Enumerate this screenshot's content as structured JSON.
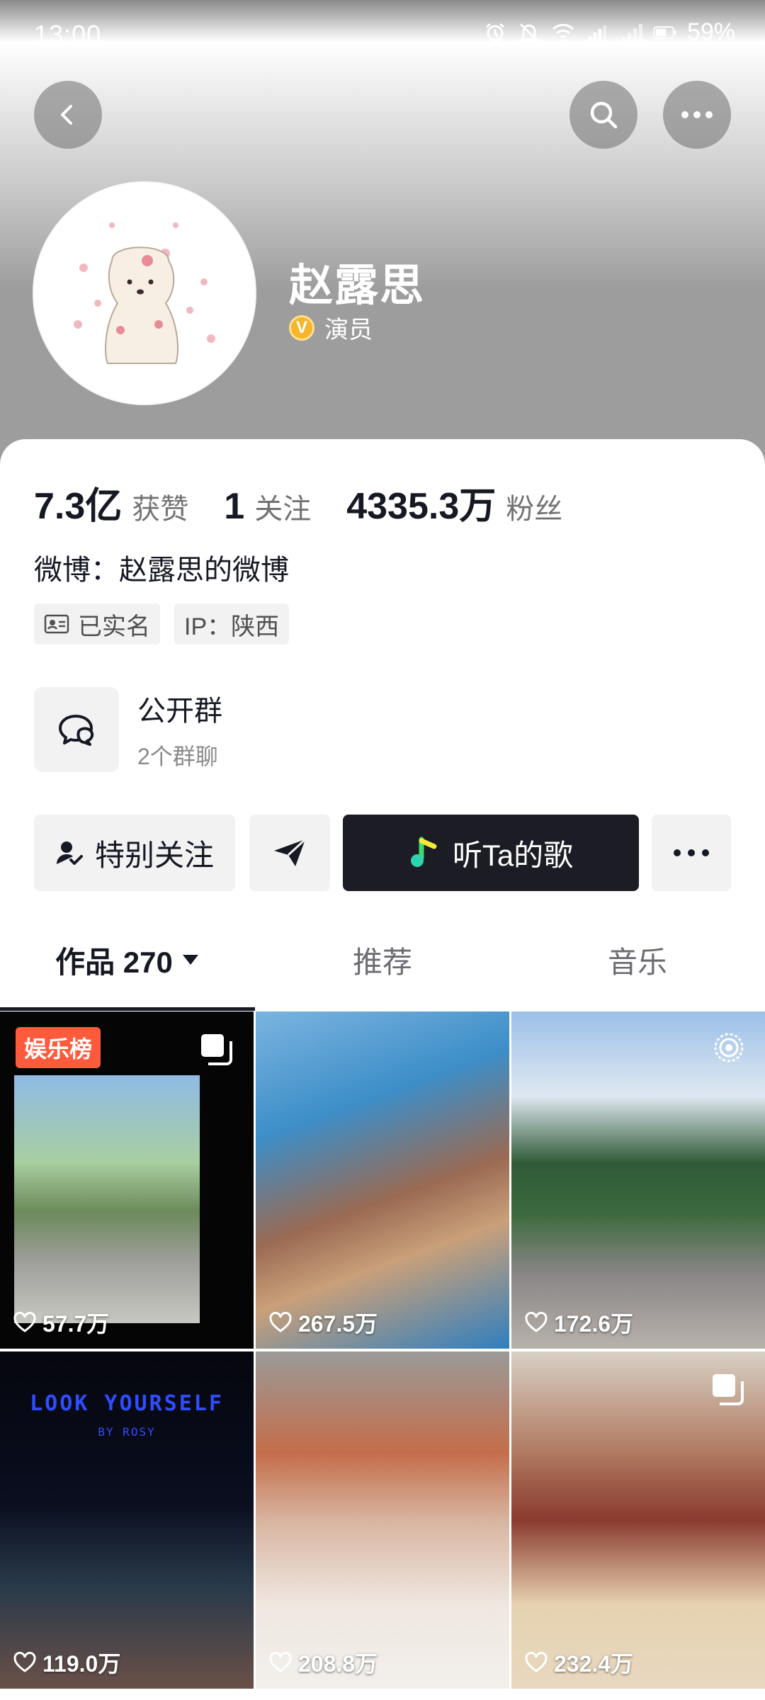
{
  "status_bar": {
    "time": "13:00",
    "battery": "59%"
  },
  "profile": {
    "name": "赵露思",
    "verify_label": "演员",
    "stats": [
      {
        "value": "7.3亿",
        "label": "获赞"
      },
      {
        "value": "1",
        "label": "关注"
      },
      {
        "value": "4335.3万",
        "label": "粉丝"
      }
    ],
    "weibo": "微博：赵露思的微博",
    "tags": {
      "real_name": "已实名",
      "ip": "IP：陕西"
    },
    "group": {
      "title": "公开群",
      "subtitle": "2个群聊"
    }
  },
  "actions": {
    "follow_label": "特别关注",
    "music_label": "听Ta的歌"
  },
  "tabs": {
    "works": "作品 270",
    "recommend": "推荐",
    "music": "音乐"
  },
  "videos": [
    {
      "likes": "57.7万",
      "badge": "娱乐榜"
    },
    {
      "likes": "267.5万"
    },
    {
      "likes": "172.6万"
    },
    {
      "likes": "119.0万",
      "title": "LOOK YOURSELF",
      "byline": "BY ROSY"
    },
    {
      "likes": "208.8万"
    },
    {
      "likes": "232.4万"
    }
  ]
}
